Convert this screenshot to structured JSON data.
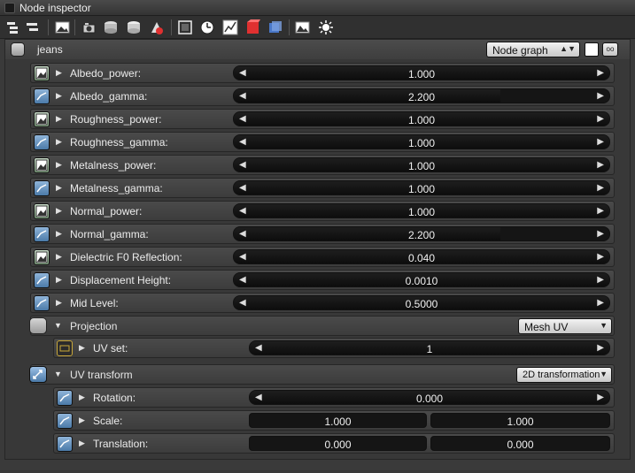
{
  "window": {
    "title": "Node inspector"
  },
  "toolbar": {
    "icons": [
      "expand-icon",
      "collapse-icon",
      "image-icon",
      "camera-icon",
      "stack-icon",
      "stack-alt-icon",
      "node-red-icon",
      "render-region-icon",
      "clock-icon",
      "graph-icon",
      "red-cube-icon",
      "blue-cube-icon",
      "picture-icon",
      "sun-icon"
    ]
  },
  "header": {
    "title": "jeans",
    "view_select": "Node graph"
  },
  "params": [
    {
      "label": "Albedo_power:",
      "value": "1.000",
      "fill": 1.0,
      "pin": "tex"
    },
    {
      "label": "Albedo_gamma:",
      "value": "2.200",
      "fill": 0.71,
      "pin": "float"
    },
    {
      "label": "Roughness_power:",
      "value": "1.000",
      "fill": 1.0,
      "pin": "tex"
    },
    {
      "label": "Roughness_gamma:",
      "value": "1.000",
      "fill": 1.0,
      "pin": "float"
    },
    {
      "label": "Metalness_power:",
      "value": "1.000",
      "fill": 1.0,
      "pin": "tex"
    },
    {
      "label": "Metalness_gamma:",
      "value": "1.000",
      "fill": 1.0,
      "pin": "float"
    },
    {
      "label": "Normal_power:",
      "value": "1.000",
      "fill": 1.0,
      "pin": "tex"
    },
    {
      "label": "Normal_gamma:",
      "value": "2.200",
      "fill": 0.71,
      "pin": "float"
    },
    {
      "label": "Dielectric F0 Reflection:",
      "value": "0.040",
      "fill": 1.0,
      "pin": "tex"
    },
    {
      "label": "Displacement Height:",
      "value": "0.0010",
      "fill": 1.0,
      "pin": "float"
    },
    {
      "label": "Mid Level:",
      "value": "0.5000",
      "fill": 1.0,
      "pin": "float"
    }
  ],
  "projection": {
    "label": "Projection",
    "mode": "Mesh UV",
    "uv_set": {
      "label": "UV set:",
      "value": "1"
    }
  },
  "uv_transform": {
    "label": "UV transform",
    "mode": "2D transformation",
    "rotation": {
      "label": "Rotation:",
      "value": "0.000"
    },
    "scale": {
      "label": "Scale:",
      "x": "1.000",
      "y": "1.000"
    },
    "translation": {
      "label": "Translation:",
      "x": "0.000",
      "y": "0.000"
    }
  },
  "colors": {
    "background": "#3a3a3a",
    "pin_blue": "#4b7aa8",
    "red_cube": "#e03030",
    "blue_cube": "#4a78c8"
  }
}
